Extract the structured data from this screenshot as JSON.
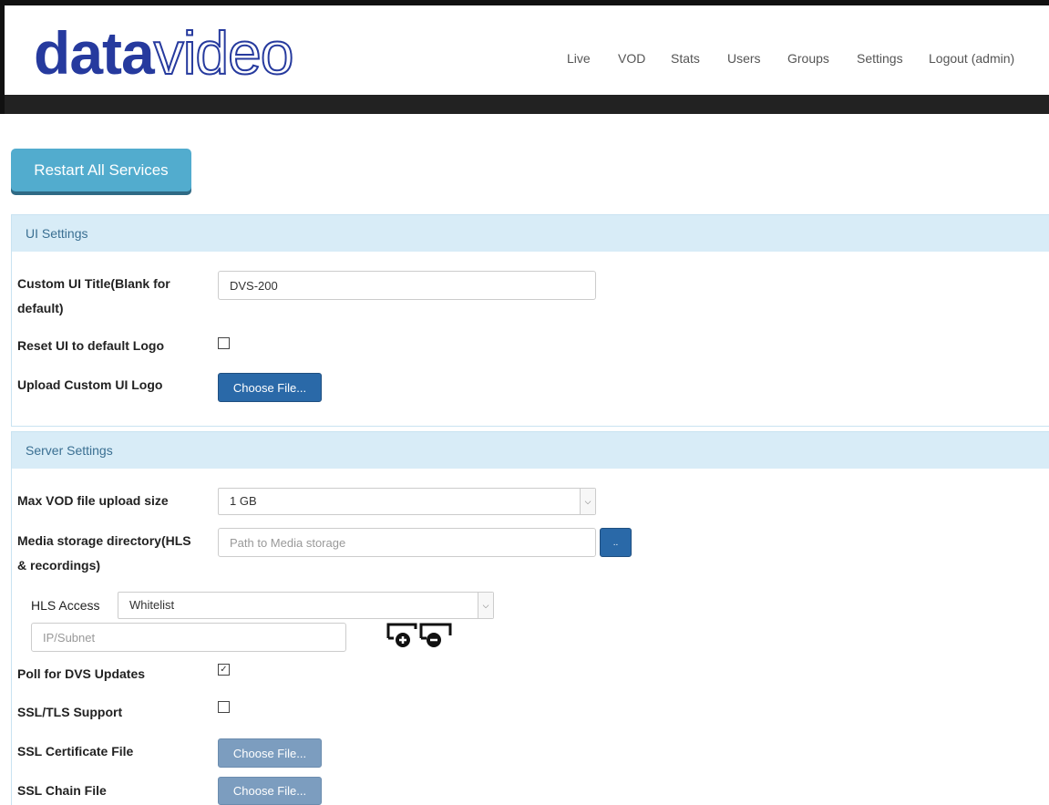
{
  "brand": {
    "logo_bold": "data",
    "logo_light": "video"
  },
  "nav": {
    "items": [
      {
        "label": "Live"
      },
      {
        "label": "VOD"
      },
      {
        "label": "Stats"
      },
      {
        "label": "Users"
      },
      {
        "label": "Groups"
      },
      {
        "label": "Settings"
      },
      {
        "label": "Logout (admin)"
      }
    ]
  },
  "actions": {
    "restart_label": "Restart All Services"
  },
  "ui_settings": {
    "title": "UI Settings",
    "custom_title_label_line1": "Custom UI Title(Blank for",
    "custom_title_label_line2": "default)",
    "custom_title_value": "DVS-200",
    "reset_logo_label": "Reset UI to default Logo",
    "reset_logo_checked": false,
    "upload_logo_label": "Upload Custom UI Logo",
    "choose_file_label": "Choose File..."
  },
  "server_settings": {
    "title": "Server Settings",
    "max_upload_label": "Max VOD file upload size",
    "max_upload_value": "1 GB",
    "media_dir_label_line1": "Media storage directory(HLS",
    "media_dir_label_line2": "& recordings)",
    "media_dir_placeholder": "Path to Media storage",
    "browse_label": "..",
    "hls_access_label": "HLS Access",
    "hls_access_value": "Whitelist",
    "ip_subnet_placeholder": "IP/Subnet",
    "poll_updates_label": "Poll for DVS Updates",
    "poll_updates_checked": true,
    "ssl_support_label": "SSL/TLS Support",
    "ssl_support_checked": false,
    "ssl_cert_label": "SSL Certificate File",
    "ssl_chain_label": "SSL Chain File",
    "choose_file_label": "Choose File..."
  },
  "colors": {
    "logo": "#263a9e",
    "header_bar": "#222222",
    "restart_button": "#52acce",
    "panel_header": "#d8ecf7",
    "panel_header_text": "#3a6f92",
    "primary_button": "#2a69a8",
    "disabled_button": "#7c9dbf"
  }
}
